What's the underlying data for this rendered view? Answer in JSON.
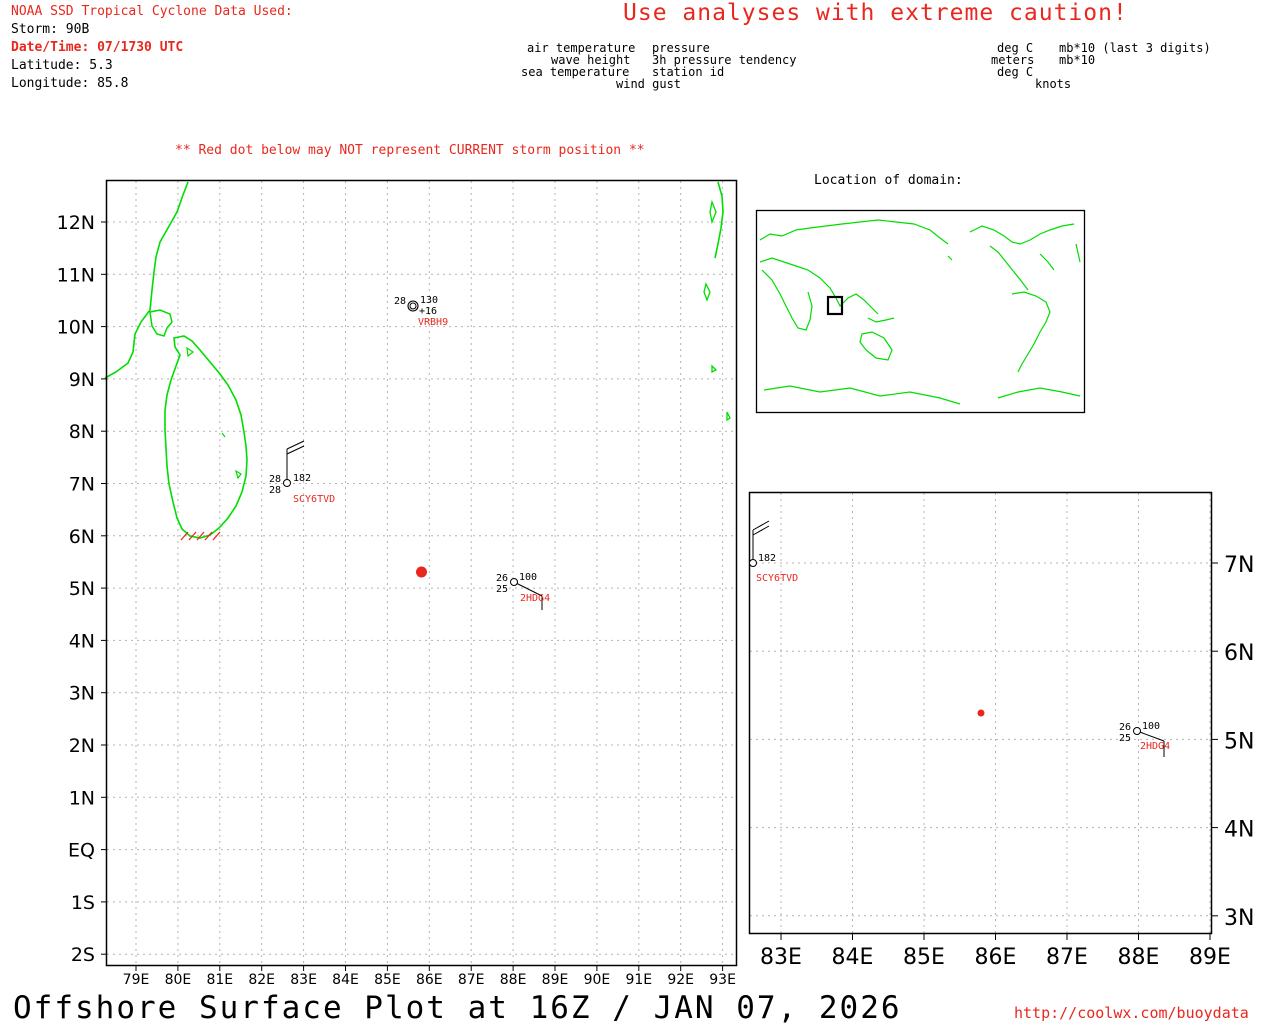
{
  "header": {
    "source_label": "NOAA SSD Tropical Cyclone Data Used:",
    "storm": "Storm: 90B",
    "datetime": "Date/Time: 07/1730 UTC",
    "latitude": "Latitude: 5.3",
    "longitude": "Longitude: 85.8",
    "caution": "Use analyses with extreme caution!",
    "red_dot_note": "** Red dot below may NOT represent CURRENT storm position **"
  },
  "legend": {
    "air_temperature": "air temperature",
    "wave_height": "wave height",
    "sea_temperature": "sea temperature",
    "wind_gust": "wind gust",
    "pressure": "pressure",
    "pressure_tendency": "3h pressure tendency",
    "station_id": "station id",
    "unit_deg_c_1": "deg C",
    "unit_meters": "meters",
    "unit_deg_c_2": "deg C",
    "unit_mb": "mb*10 (last 3 digits)",
    "unit_mb2": "mb*10",
    "unit_knots": "knots"
  },
  "colors": {
    "land": "#00dd00",
    "alert": "#e8281e",
    "grid": "#b4b4b4",
    "frame": "#000000"
  },
  "main_map": {
    "lat_labels": [
      "12N",
      "11N",
      "10N",
      "9N",
      "8N",
      "7N",
      "6N",
      "5N",
      "4N",
      "3N",
      "2N",
      "1N",
      "EQ",
      "1S",
      "2S"
    ],
    "lon_labels": [
      "79E",
      "80E",
      "81E",
      "82E",
      "83E",
      "84E",
      "85E",
      "86E",
      "87E",
      "88E",
      "89E",
      "90E",
      "91E",
      "92E",
      "93E"
    ],
    "stations": [
      {
        "id": "VRBH9",
        "air_temp": "28",
        "pressure": "130",
        "tendency": "+16",
        "lat": 10.5,
        "lon": 85.7
      },
      {
        "id": "SCY6TVD",
        "air_temp": "28",
        "sea_temp": "28",
        "pressure": "182",
        "lat": 7.0,
        "lon": 82.6
      },
      {
        "id": "2HDG4",
        "air_temp": "26",
        "sea_temp": "25",
        "pressure": "100",
        "lat": 5.1,
        "lon": 88.0
      }
    ],
    "storm_position": {
      "lat": 5.3,
      "lon": 85.8
    }
  },
  "inset_domain": {
    "title": "Location of domain:"
  },
  "zoom_map": {
    "lat_labels": [
      "7N",
      "6N",
      "5N",
      "4N",
      "3N"
    ],
    "lon_labels": [
      "83E",
      "84E",
      "85E",
      "86E",
      "87E",
      "88E",
      "89E"
    ],
    "stations": [
      {
        "id": "SCY6TVD",
        "pressure": "182"
      },
      {
        "id": "2HDG4",
        "air_temp": "26",
        "sea_temp": "25",
        "pressure": "100"
      }
    ]
  },
  "footer": {
    "title": "Offshore Surface Plot at 16Z / JAN 07, 2026",
    "url": "http://coolwx.com/buoydata"
  }
}
